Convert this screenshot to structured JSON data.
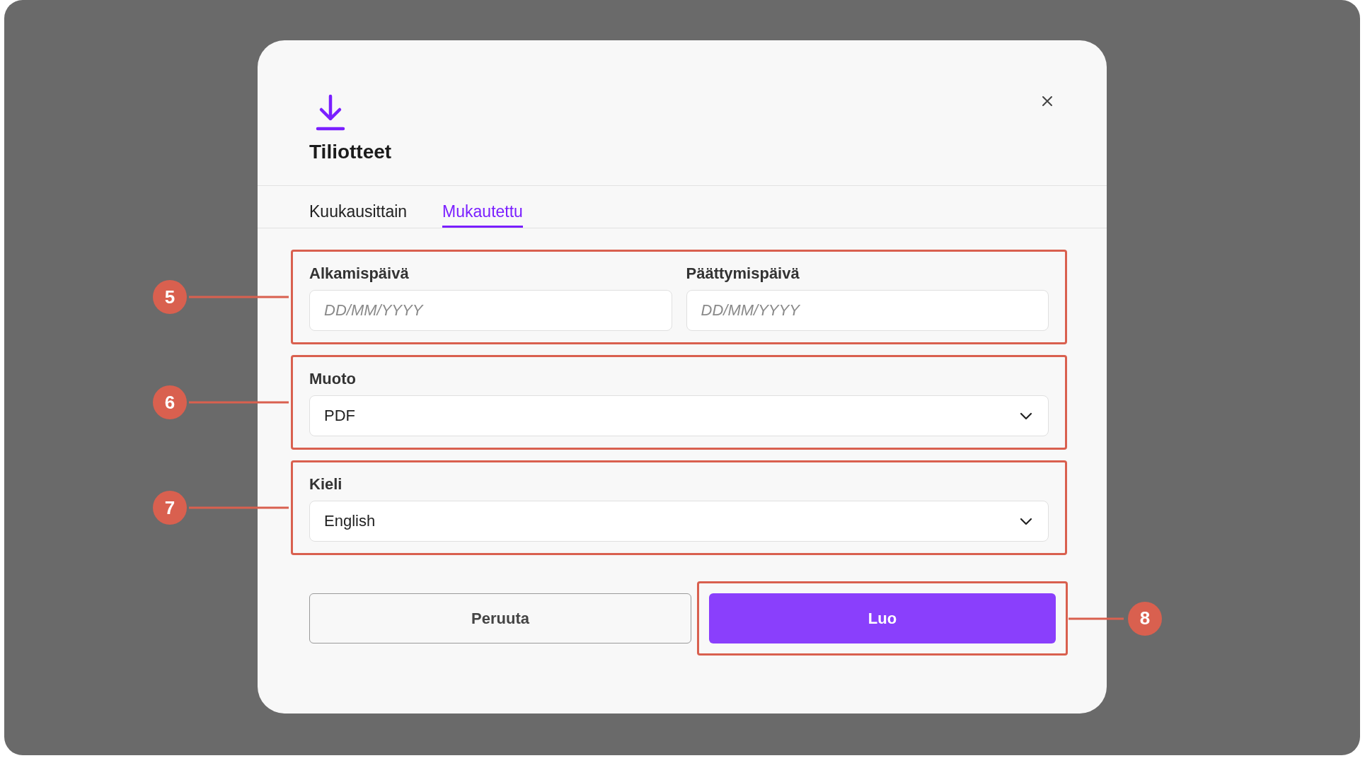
{
  "dialog": {
    "title": "Tiliotteet",
    "tabs": [
      {
        "label": "Kuukausittain",
        "selected": false
      },
      {
        "label": "Mukautettu",
        "selected": true
      }
    ],
    "sections": [
      {
        "kind": "date-range",
        "callout": "5",
        "fields": [
          {
            "label": "Alkamispäivä",
            "placeholder": "DD/MM/YYYY"
          },
          {
            "label": "Päättymispäivä",
            "placeholder": "DD/MM/YYYY"
          }
        ]
      },
      {
        "kind": "select",
        "callout": "6",
        "label": "Muoto",
        "value": "PDF"
      },
      {
        "kind": "select",
        "callout": "7",
        "label": "Kieli",
        "value": "English"
      }
    ],
    "buttons": [
      {
        "kind": "secondary",
        "label": "Peruuta"
      },
      {
        "kind": "primary",
        "label": "Luo",
        "callout": "8"
      }
    ]
  }
}
